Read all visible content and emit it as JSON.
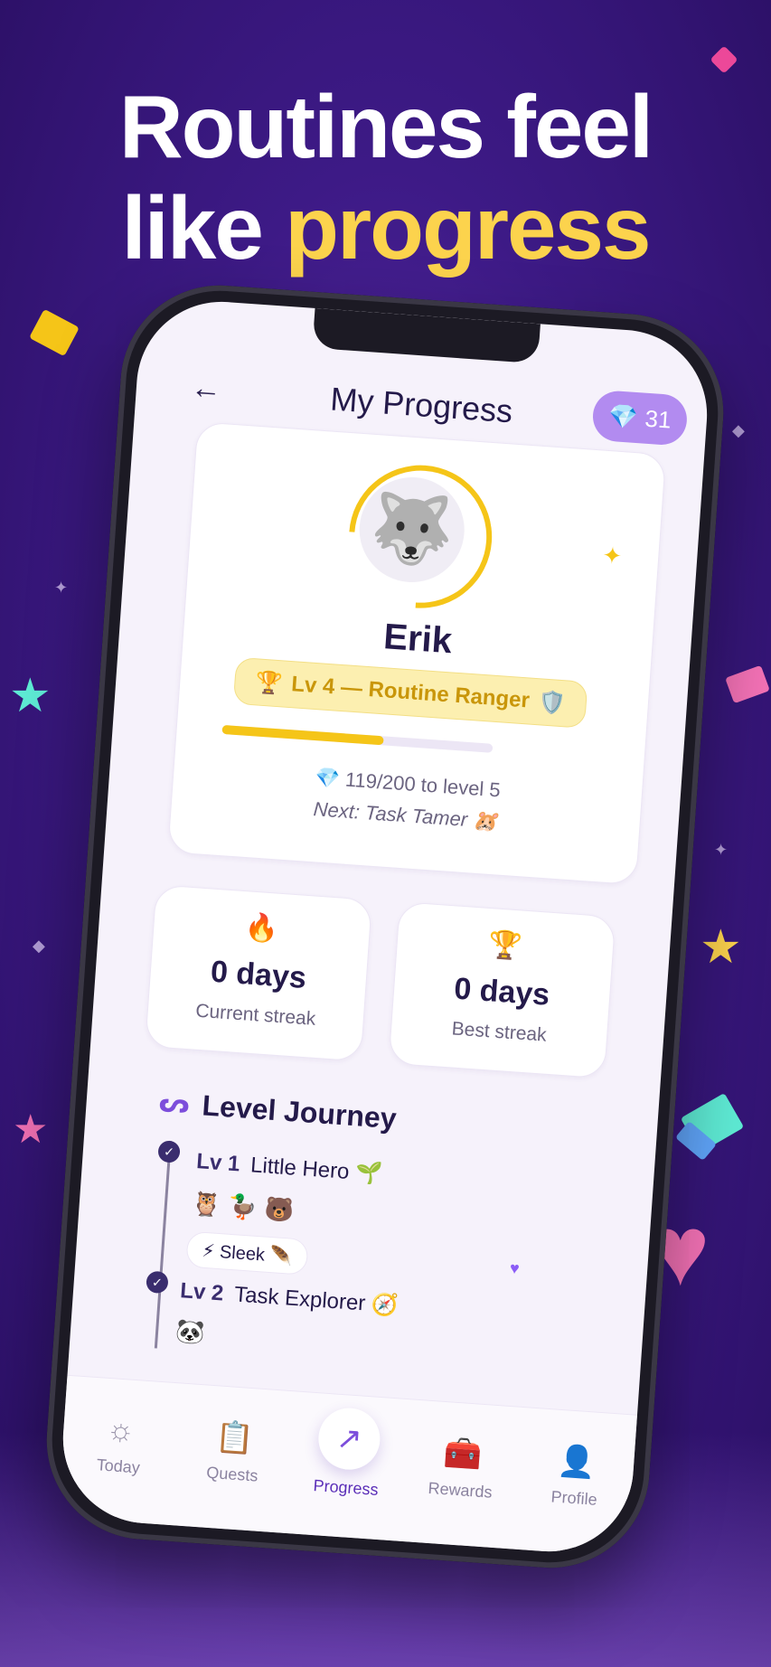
{
  "headline": {
    "line1": "Routines feel",
    "line2_prefix": "like ",
    "line2_accent": "progress"
  },
  "header": {
    "title": "My Progress",
    "back_icon": "arrow-left-icon",
    "gems": "31",
    "gem_icon": "💎"
  },
  "profile": {
    "name": "Erik",
    "avatar": "🐺",
    "level_label": "Lv 4 — Routine Ranger",
    "level_prefix_icon": "🏆",
    "level_suffix_icon": "🛡️",
    "xp_progress": 0.595,
    "xp_text": "💎 119/200 to level 5",
    "next_text": "Next: Task Tamer 🐹"
  },
  "stats": [
    {
      "icon": "🔥",
      "value": "0 days",
      "label": "Current streak"
    },
    {
      "icon": "🏆",
      "value": "0 days",
      "label": "Best streak"
    }
  ],
  "journey": {
    "title": "Level Journey",
    "levels": [
      {
        "lv": "Lv 1",
        "name": "Little Hero 🌱",
        "emojis": "🦉🦆🐻",
        "badge": "⚡ Sleek 🪶"
      },
      {
        "lv": "Lv 2",
        "name": "Task Explorer 🧭",
        "emojis": "🐼"
      }
    ]
  },
  "nav": [
    {
      "label": "Today",
      "icon": "☼"
    },
    {
      "label": "Quests",
      "icon": "📋"
    },
    {
      "label": "Progress",
      "icon": "↗"
    },
    {
      "label": "Rewards",
      "icon": "🧰"
    },
    {
      "label": "Profile",
      "icon": "👤"
    }
  ],
  "colors": {
    "accent": "#7c4ddb",
    "gold": "#f5c518",
    "background": "#3d1a86"
  }
}
